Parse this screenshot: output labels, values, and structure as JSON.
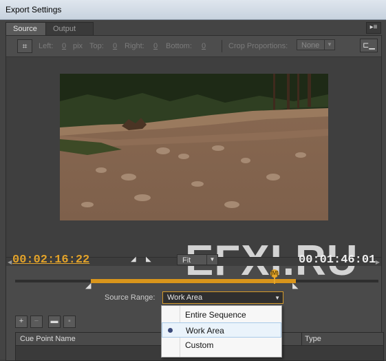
{
  "window": {
    "title": "Export Settings"
  },
  "tabs": [
    {
      "label": "Source"
    },
    {
      "label": "Output"
    }
  ],
  "crop": {
    "left_label": "Left:",
    "left_value": "0",
    "left_unit": "pix",
    "top_label": "Top:",
    "top_value": "0",
    "right_label": "Right:",
    "right_value": "0",
    "bottom_label": "Bottom:",
    "bottom_value": "0",
    "proportions_label": "Crop Proportions:",
    "proportions_value": "None"
  },
  "watermark": "EFXI.RU",
  "playback": {
    "current_time": "00:02:16:22",
    "duration": "00:01:46:01",
    "zoom": "Fit",
    "playhead_marker": "[M]"
  },
  "source_range": {
    "label": "Source Range:",
    "value": "Work Area",
    "options": [
      {
        "label": "Entire Sequence",
        "selected": false
      },
      {
        "label": "Work Area",
        "selected": true
      },
      {
        "label": "Custom",
        "selected": false
      }
    ]
  },
  "cue_points": {
    "columns": [
      "Cue Point Name",
      "Type"
    ]
  },
  "colors": {
    "accent": "#d9951b",
    "timecode": "#e3a32a"
  }
}
